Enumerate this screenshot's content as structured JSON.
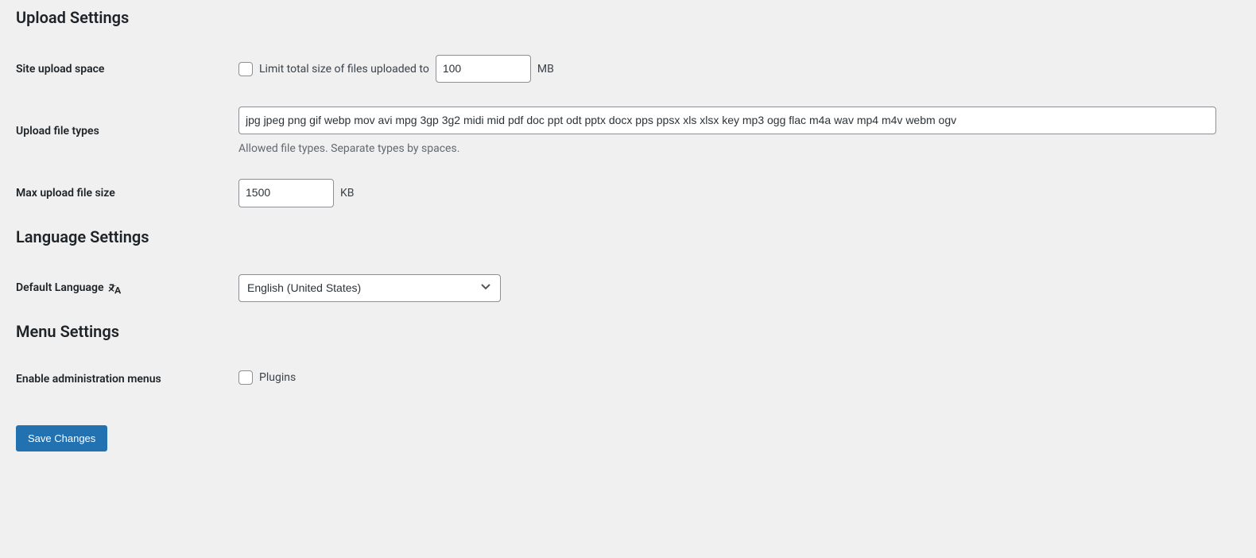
{
  "sections": {
    "upload": {
      "heading": "Upload Settings",
      "fields": {
        "site_upload_space": {
          "label": "Site upload space",
          "checkbox_text": "Limit total size of files uploaded to",
          "value": "100",
          "unit": "MB"
        },
        "upload_file_types": {
          "label": "Upload file types",
          "value": "jpg jpeg png gif webp mov avi mpg 3gp 3g2 midi mid pdf doc ppt odt pptx docx pps ppsx xls xlsx key mp3 ogg flac m4a wav mp4 m4v webm ogv",
          "description": "Allowed file types. Separate types by spaces."
        },
        "max_upload_file_size": {
          "label": "Max upload file size",
          "value": "1500",
          "unit": "KB"
        }
      }
    },
    "language": {
      "heading": "Language Settings",
      "fields": {
        "default_language": {
          "label": "Default Language",
          "selected": "English (United States)"
        }
      }
    },
    "menu": {
      "heading": "Menu Settings",
      "fields": {
        "enable_admin_menus": {
          "label": "Enable administration menus",
          "checkbox_text": "Plugins"
        }
      }
    }
  },
  "buttons": {
    "save": "Save Changes"
  }
}
